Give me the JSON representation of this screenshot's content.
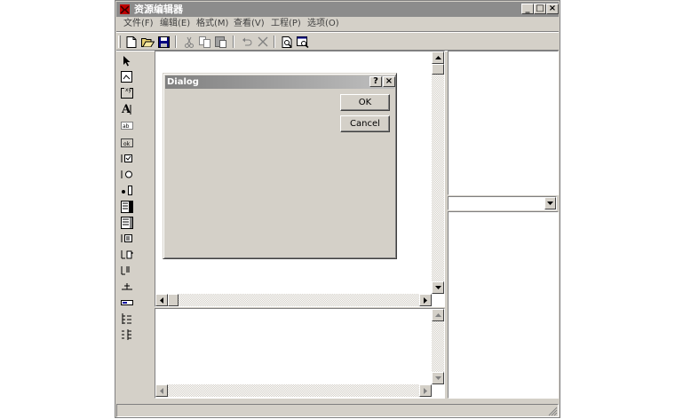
{
  "window": {
    "title": "资源编辑器",
    "caption_buttons": [
      "_",
      "□",
      "×"
    ]
  },
  "menu": {
    "items": [
      "文件(F)",
      "编辑(E)",
      "格式(M)",
      "查看(V)",
      "工程(P)",
      "选项(O)"
    ]
  },
  "toolbar": {
    "buttons": [
      "new-icon",
      "open-icon",
      "save-icon",
      "cut-icon",
      "copy-icon",
      "paste-icon",
      "undo-icon",
      "delete-icon",
      "test-dialog-icon",
      "preview-icon"
    ]
  },
  "palette": {
    "tools": [
      "pointer",
      "picture",
      "group-box",
      "static-text",
      "edit-text",
      "button",
      "check-box",
      "radio-button",
      "combo-box",
      "list-box",
      "scrollbar",
      "spin",
      "slider",
      "progress",
      "hotkey",
      "list-view",
      "tree-view"
    ]
  },
  "dialog": {
    "title": "Dialog",
    "help_button": "?",
    "close_button": "×",
    "ok_label": "OK",
    "cancel_label": "Cancel"
  },
  "colors": {
    "face": "#d4d0c8",
    "titlebar": "#8c8c8c",
    "app_icon": "#c00000"
  }
}
